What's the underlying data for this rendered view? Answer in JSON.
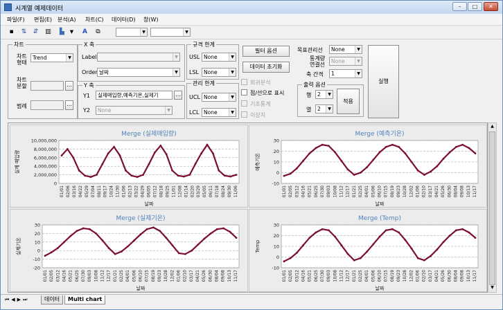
{
  "window": {
    "title": "시계열 예제데이터"
  },
  "menu": [
    "파일(F)",
    "편집(E)",
    "분석(A)",
    "차트(C)",
    "데이터(D)",
    "창(W)"
  ],
  "toolbar_icons": [
    "save-icon",
    "sort-icon",
    "sort-desc-icon",
    "columns-icon",
    "bar-chart-icon",
    "text-icon",
    "copy-icon"
  ],
  "toolbar_combos": [
    "",
    ""
  ],
  "chart_group": {
    "title": "차트",
    "type_label": "차트\n형태",
    "type_value": "Trend",
    "split_label": "차트\n분할",
    "legend_label": "범례"
  },
  "x_group": {
    "title": "X 축",
    "label_label": "Label",
    "label_value": "",
    "order_label": "Order",
    "order_value": "날짜"
  },
  "y_group": {
    "title": "Y 축",
    "y1_label": "Y1",
    "y1_value": "실제매입량,예측기온,실제기",
    "y2_label": "Y2",
    "y2_value": "None"
  },
  "spec_group": {
    "title": "규격 한계",
    "usl_label": "USL",
    "usl_value": "None",
    "lsl_label": "LSL",
    "lsl_value": "None"
  },
  "ctrl_group": {
    "title": "관리 한계",
    "ucl_label": "UCL",
    "ucl_value": "None",
    "lcl_label": "LCL",
    "lcl_value": "None"
  },
  "buttons": {
    "filter": "필터 옵션",
    "reset": "데이터 초기화",
    "apply": "적용",
    "run": "실행"
  },
  "checks": [
    {
      "label": "회귀분석",
      "enabled": false,
      "checked": false
    },
    {
      "label": "점/선으로 표시",
      "enabled": true,
      "checked": false
    },
    {
      "label": "기초통계",
      "enabled": false,
      "checked": false
    },
    {
      "label": "이상치",
      "enabled": false,
      "checked": false
    }
  ],
  "target": {
    "label": "목표관리선",
    "value": "None",
    "stat_label": "통계량\n연결선",
    "stat_value": "None",
    "tick_label": "축 간격",
    "tick_value": "1"
  },
  "output": {
    "title": "출력 옵션",
    "row_label": "행",
    "row_value": "2",
    "col_label": "열",
    "col_value": "2"
  },
  "sheet_tabs": [
    "데이터",
    "Multi chart"
  ],
  "colors": {
    "series": "#7a0f2e",
    "title": "#4f81bd"
  },
  "chart_data": [
    {
      "type": "line",
      "title": "Merge (실제매입량)",
      "xlabel": "날짜",
      "ylabel": "실제\n매입량",
      "categories": [
        "01/01",
        "02/06",
        "03/16",
        "04/22",
        "05/29",
        "07/04",
        "08/11",
        "09/17",
        "10/24",
        "11/30",
        "01/06",
        "02/13",
        "03/22",
        "04/29",
        "06/05",
        "07/12",
        "08/18",
        "09/25",
        "11/01",
        "12/08",
        "01/14",
        "02/20",
        "03/29",
        "05/05",
        "06/11",
        "07/18",
        "08/24",
        "09/30",
        "11/06"
      ],
      "ylim": [
        0,
        10000000
      ],
      "yticks": [
        "0",
        "2,000,000",
        "4,000,000",
        "6,000,000",
        "8,000,000",
        "10,000,000"
      ],
      "values": [
        6500000,
        8000000,
        6000000,
        3000000,
        1800000,
        1500000,
        2000000,
        4500000,
        7000000,
        8500000,
        6500000,
        3000000,
        1800000,
        1500000,
        2000000,
        4500000,
        7200000,
        8800000,
        6800000,
        3000000,
        1800000,
        1600000,
        2000000,
        4600000,
        7000000,
        9000000,
        7000000,
        3000000,
        1800000,
        1600000,
        2000000
      ]
    },
    {
      "type": "line",
      "title": "Merge (예측기온)",
      "xlabel": "날짜",
      "ylabel": "예측기온",
      "categories": [
        "01/01",
        "02/05",
        "03/12",
        "04/16",
        "05/21",
        "06/25",
        "07/30",
        "09/03",
        "10/08",
        "11/12",
        "12/17",
        "01/21",
        "02/25",
        "04/01",
        "05/06",
        "06/10",
        "07/15",
        "08/19",
        "09/23",
        "10/28",
        "12/02",
        "01/06",
        "02/10",
        "03/17",
        "04/21",
        "05/26",
        "06/30",
        "08/04",
        "09/08",
        "10/13",
        "11/17"
      ],
      "ylim": [
        -10,
        30
      ],
      "yticks": [
        "-10",
        "0",
        "10",
        "20",
        "30"
      ],
      "values": [
        -3,
        -1,
        4,
        11,
        18,
        23,
        26,
        25,
        19,
        11,
        3,
        -2,
        0,
        5,
        12,
        19,
        24,
        26,
        24,
        18,
        10,
        2,
        -2,
        1,
        6,
        13,
        19,
        24,
        26,
        23,
        18
      ]
    },
    {
      "type": "line",
      "title": "Merge (실제기온)",
      "xlabel": "날짜",
      "ylabel": "실제기온",
      "categories": [
        "01/01",
        "02/05",
        "03/12",
        "04/16",
        "05/21",
        "06/25",
        "07/30",
        "09/03",
        "10/08",
        "11/12",
        "12/17",
        "01/21",
        "02/25",
        "04/01",
        "05/06",
        "06/10",
        "07/15",
        "08/19",
        "09/23",
        "10/28",
        "12/02",
        "01/06",
        "02/10",
        "03/17",
        "04/21",
        "05/26",
        "06/30",
        "08/04",
        "09/08",
        "10/13",
        "11/17"
      ],
      "ylim": [
        -20,
        30
      ],
      "yticks": [
        "-20",
        "-10",
        "0",
        "10",
        "20",
        "30"
      ],
      "values": [
        -6,
        -2,
        3,
        10,
        17,
        23,
        26,
        25,
        20,
        12,
        3,
        -4,
        -1,
        5,
        12,
        19,
        25,
        27,
        23,
        15,
        6,
        -3,
        -4,
        0,
        7,
        14,
        20,
        25,
        26,
        22,
        15
      ]
    },
    {
      "type": "line",
      "title": "Merge (Temp)",
      "xlabel": "날짜",
      "ylabel": "Temp",
      "categories": [
        "01/01",
        "02/05",
        "03/12",
        "04/16",
        "05/21",
        "06/25",
        "07/30",
        "09/03",
        "10/08",
        "11/12",
        "12/17",
        "01/21",
        "02/25",
        "04/01",
        "05/06",
        "06/10",
        "07/15",
        "08/19",
        "09/23",
        "10/28",
        "12/02",
        "01/06",
        "02/10",
        "03/17",
        "04/21",
        "05/26",
        "06/30",
        "08/04",
        "09/08",
        "10/13",
        "11/17"
      ],
      "ylim": [
        -10,
        30
      ],
      "yticks": [
        "-10",
        "0",
        "10",
        "20",
        "30"
      ],
      "values": [
        -4,
        -1,
        4,
        11,
        18,
        23,
        26,
        25,
        19,
        11,
        3,
        -3,
        -1,
        5,
        12,
        19,
        25,
        26,
        23,
        16,
        8,
        -1,
        -3,
        1,
        7,
        14,
        20,
        25,
        26,
        23,
        18
      ]
    }
  ]
}
